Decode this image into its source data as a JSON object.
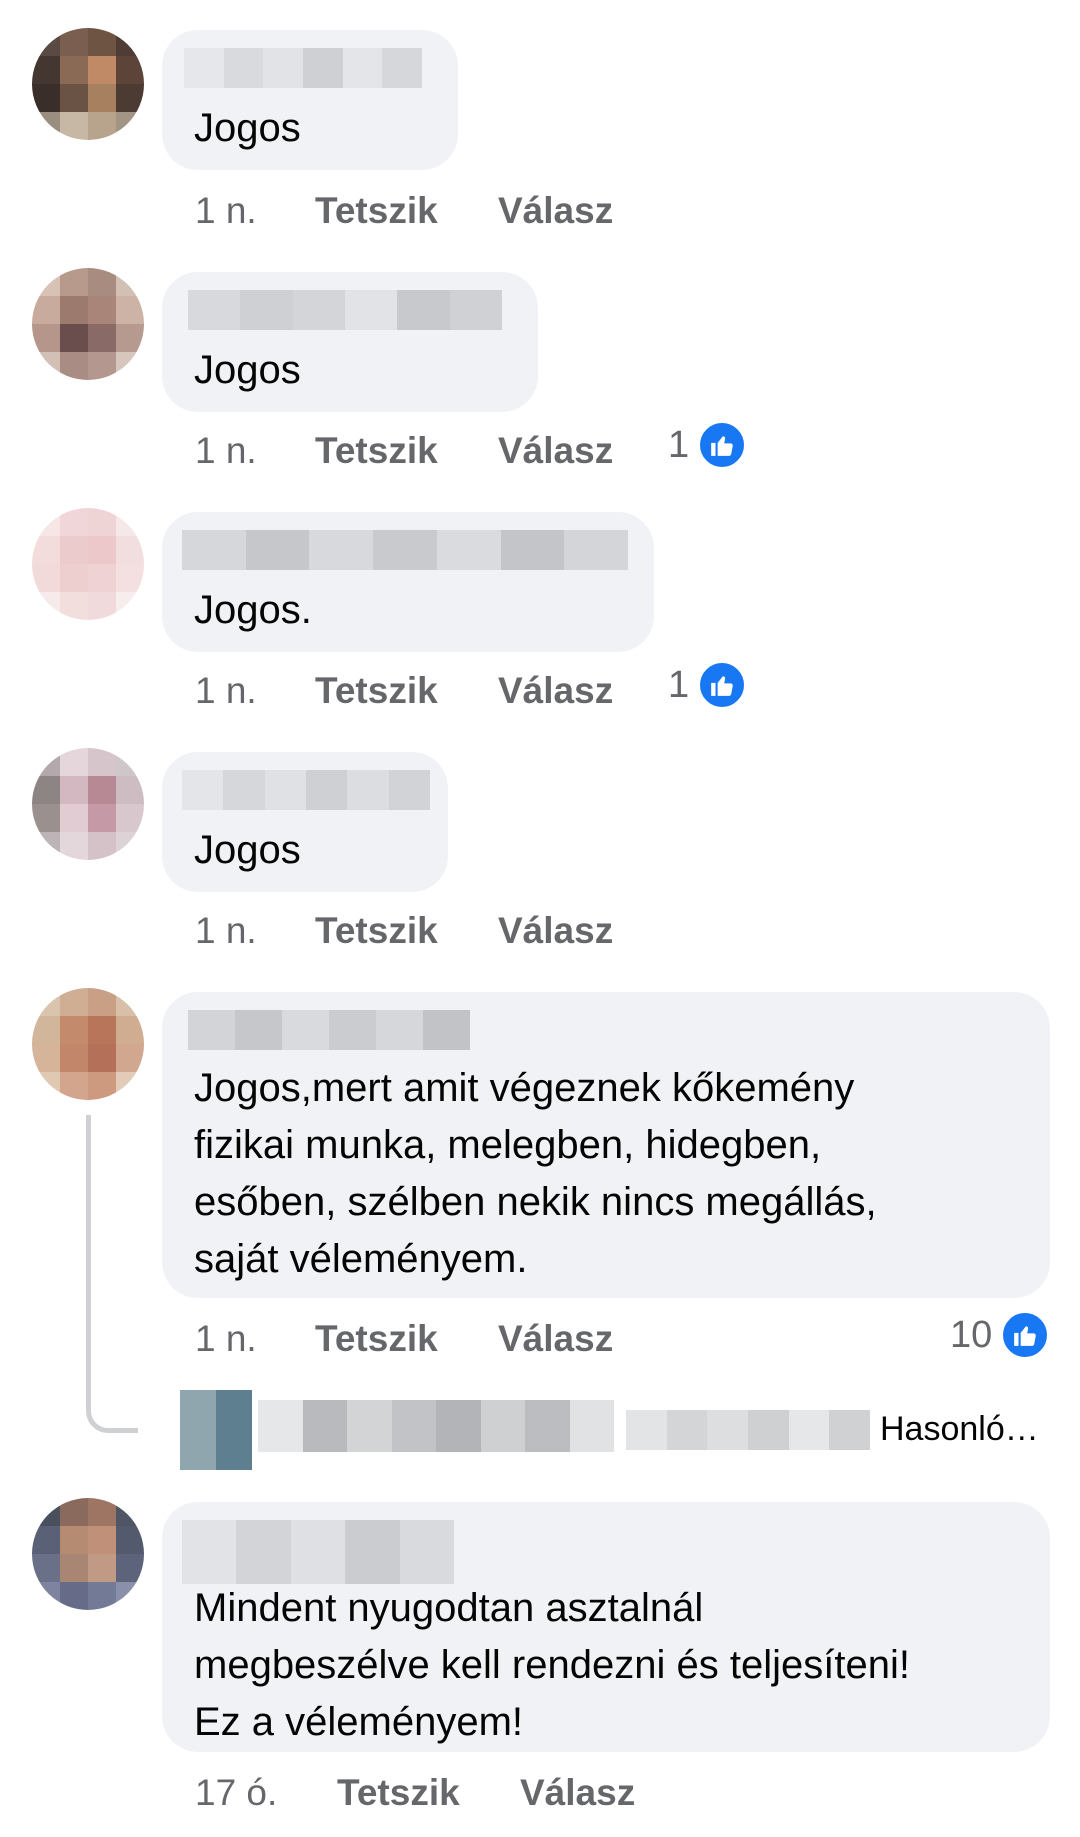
{
  "comments": [
    {
      "text": "Jogos",
      "time": "1 n.",
      "like": "Tetszik",
      "reply": "Válasz",
      "reactions": null
    },
    {
      "text": "Jogos",
      "time": "1 n.",
      "like": "Tetszik",
      "reply": "Válasz",
      "reactions": "1"
    },
    {
      "text": "Jogos.",
      "time": "1 n.",
      "like": "Tetszik",
      "reply": "Válasz",
      "reactions": "1"
    },
    {
      "text": "Jogos",
      "time": "1 n.",
      "like": "Tetszik",
      "reply": "Válasz",
      "reactions": null
    },
    {
      "text": "Jogos,mert amit végeznek kőkemény\nfizikai munka, melegben, hidegben,\nesőben, szélben nekik nincs megállás,\nsaját véleményem.",
      "time": "1 n.",
      "like": "Tetszik",
      "reply": "Válasz",
      "reactions": "10"
    },
    {
      "text": "Mindent nyugodtan asztalnál\nmegbeszélve kell rendezni és teljesíteni!\nEz a véleményem!",
      "time": "17 ó.",
      "like": "Tetszik",
      "reply": "Válasz",
      "reactions": null
    }
  ],
  "replies_preview": {
    "label": "Hasonló…"
  },
  "icons": {
    "reaction": "thumbs-up-icon",
    "thread": "thread-connector"
  },
  "colors": {
    "bubble": "#f0f2f5",
    "meta_text": "#65676b",
    "like_blue": "#1877f2"
  }
}
